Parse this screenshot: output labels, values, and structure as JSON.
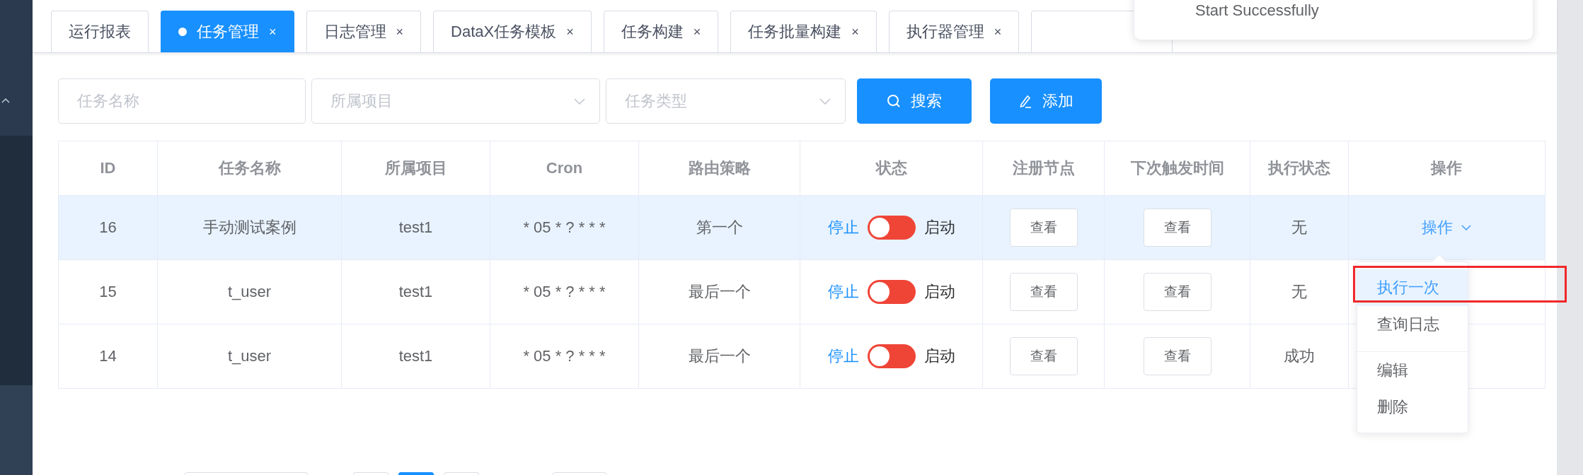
{
  "tabs": [
    {
      "label": "运行报表",
      "selected": false,
      "closable": false
    },
    {
      "label": "任务管理",
      "selected": true,
      "closable": true
    },
    {
      "label": "日志管理",
      "selected": false,
      "closable": true
    },
    {
      "label": "DataX任务模板",
      "selected": false,
      "closable": true
    },
    {
      "label": "任务构建",
      "selected": false,
      "closable": true
    },
    {
      "label": "任务批量构建",
      "selected": false,
      "closable": true
    },
    {
      "label": "执行器管理",
      "selected": false,
      "closable": true
    },
    {
      "selected": false,
      "closable": false
    }
  ],
  "close_glyph": "×",
  "notification": {
    "message": "Start Successfully"
  },
  "filters": {
    "name": {
      "placeholder": "任务名称"
    },
    "project": {
      "placeholder": "所属项目"
    },
    "type": {
      "placeholder": "任务类型"
    },
    "search_button": "搜索",
    "add_button": "添加"
  },
  "table": {
    "columns": [
      "ID",
      "任务名称",
      "所属项目",
      "Cron",
      "路由策略",
      "状态",
      "注册节点",
      "下次触发时间",
      "执行状态",
      "操作"
    ],
    "rows": [
      {
        "id": "16",
        "name": "手动测试案例",
        "project": "test1",
        "cron": "* 05 * ? * * *",
        "route": "第一个",
        "stop_label": "停止",
        "on": false,
        "start_label": "启动",
        "nodes_button": "查看",
        "next_button": "查看",
        "exec_status": "无",
        "action": "操作",
        "selected": true
      },
      {
        "id": "15",
        "name": "t_user",
        "project": "test1",
        "cron": "* 05 * ? * * *",
        "route": "最后一个",
        "stop_label": "停止",
        "on": false,
        "start_label": "启动",
        "nodes_button": "查看",
        "next_button": "查看",
        "exec_status": "无",
        "selected": false
      },
      {
        "id": "14",
        "name": "t_user",
        "project": "test1",
        "cron": "* 05 * ? * * *",
        "route": "最后一个",
        "stop_label": "停止",
        "on": false,
        "start_label": "启动",
        "nodes_button": "查看",
        "next_button": "查看",
        "exec_status": "成功",
        "selected": false
      }
    ]
  },
  "action_menu": {
    "items": [
      {
        "label": "执行一次",
        "selected": true,
        "divided": false
      },
      {
        "label": "查询日志",
        "selected": false,
        "divided": false
      },
      {
        "label": "编辑",
        "selected": false,
        "divided": true
      },
      {
        "label": "删除",
        "selected": false,
        "divided": false
      }
    ]
  }
}
